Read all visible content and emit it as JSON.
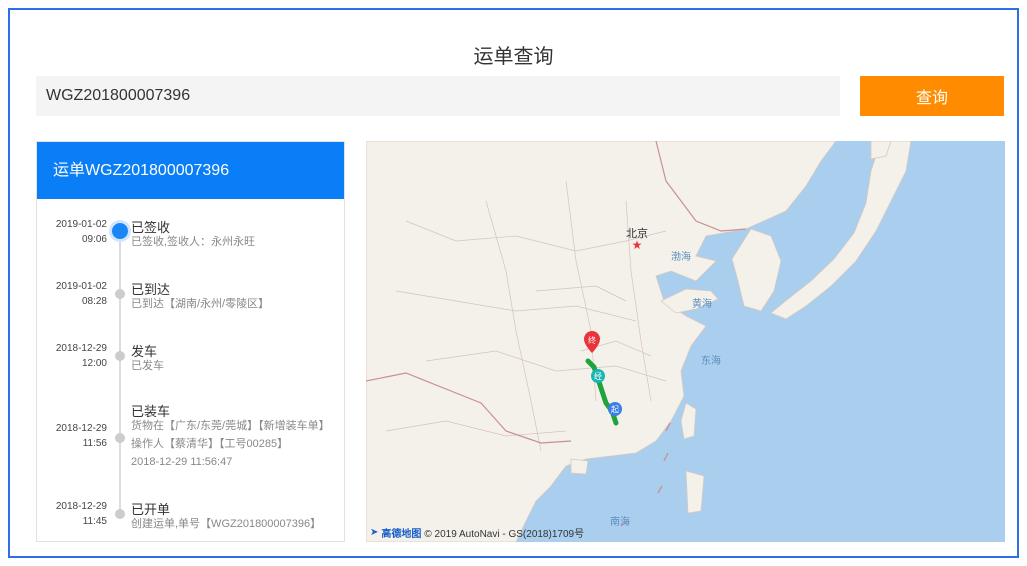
{
  "page": {
    "title": "运单查询"
  },
  "search": {
    "value": "WGZ201800007396",
    "button_label": "查询"
  },
  "panel": {
    "header": "运单WGZ201800007396",
    "events": [
      {
        "date": "2019-01-02",
        "time": "09:06",
        "title": "已签收",
        "desc": "已签收,签收人：永州永旺",
        "active": true
      },
      {
        "date": "2019-01-02",
        "time": "08:28",
        "title": "已到达",
        "desc": "已到达【湖南/永州/零陵区】",
        "active": false
      },
      {
        "date": "2018-12-29",
        "time": "12:00",
        "title": "发车",
        "desc": "已发车",
        "active": false
      },
      {
        "date": "2018-12-29",
        "time": "11:56",
        "title": "已装车",
        "desc": "货物在【广东/东莞/莞城】【新增装车单】操作人【蔡清华】【工号00285】",
        "extra": "2018-12-29 11:56:47",
        "active": false
      },
      {
        "date": "2018-12-29",
        "time": "11:45",
        "title": "已开单",
        "desc": "创建运单,单号【WGZ201800007396】",
        "active": false
      }
    ]
  },
  "map": {
    "labels": {
      "beijing": "北京",
      "bohai": "渤海",
      "huanghai": "黄海",
      "donghai": "东海",
      "nanhai": "南海"
    },
    "markers": {
      "end": "终",
      "via": "经",
      "start": "起"
    },
    "credit_logo": "高德地图",
    "credit_text": "© 2019 AutoNavi - GS(2018)1709号",
    "colors": {
      "water": "#a9ceee",
      "land": "#f4f1ea",
      "route": "#1fa33a",
      "start": "#3a7ee8",
      "end": "#e8343a",
      "via": "#1bb6b1"
    }
  }
}
